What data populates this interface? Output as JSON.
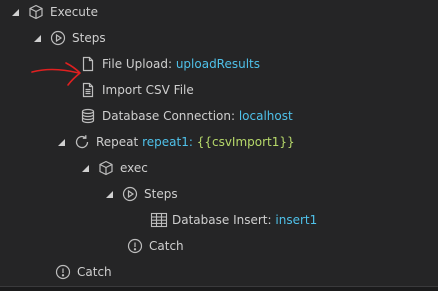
{
  "tree": {
    "execute": {
      "label": "Execute"
    },
    "steps_outer": {
      "label": "Steps"
    },
    "file_upload": {
      "label": "File Upload:",
      "value": "uploadResults"
    },
    "import_csv": {
      "label": "Import CSV File"
    },
    "db_connection": {
      "label": "Database Connection:",
      "value": "localhost"
    },
    "repeat": {
      "label": "Repeat",
      "value": "repeat1:",
      "expression": "{{csvImport1}}"
    },
    "exec": {
      "label": "exec"
    },
    "steps_inner": {
      "label": "Steps"
    },
    "db_insert": {
      "label": "Database Insert:",
      "value": "insert1"
    },
    "catch_inner": {
      "label": "Catch"
    },
    "catch_outer": {
      "label": "Catch"
    }
  },
  "colors": {
    "background": "#252526",
    "text": "#cccccc",
    "value": "#4fc1e9",
    "expression": "#b6d86a",
    "annotation": "#e02020"
  },
  "icons": {
    "execute": "cube-icon",
    "steps": "play-circle-icon",
    "file": "file-icon",
    "file_lines": "file-lines-icon",
    "database": "database-icon",
    "repeat": "repeat-icon",
    "table": "table-icon",
    "catch": "exclamation-circle-icon"
  }
}
